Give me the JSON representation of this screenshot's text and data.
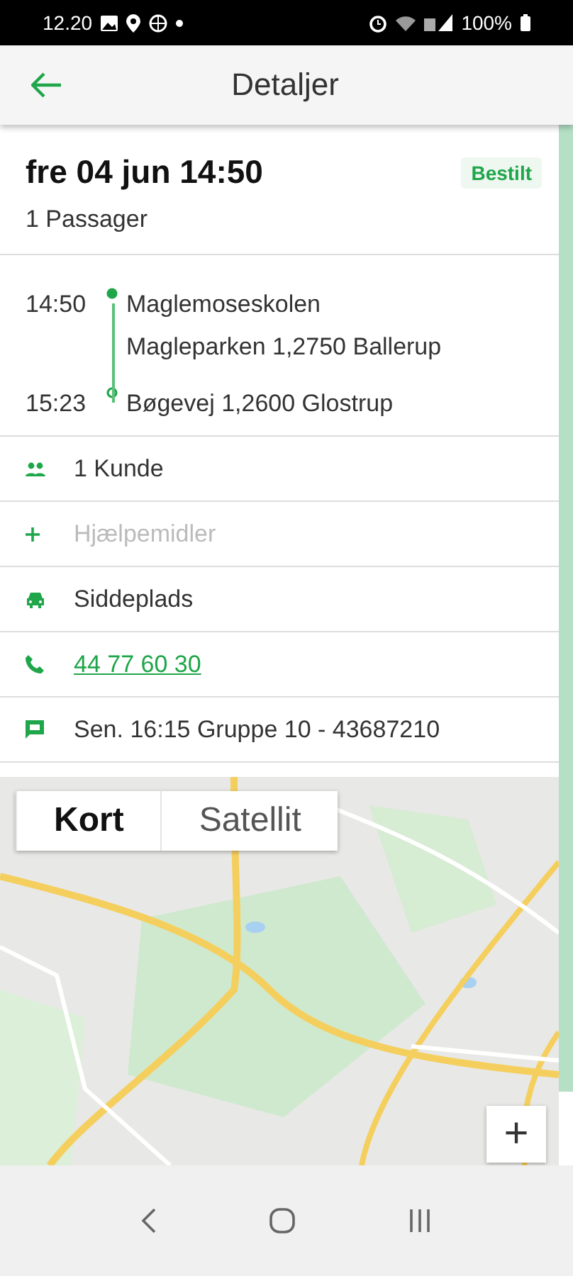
{
  "status_bar": {
    "time": "12.20",
    "battery": "100%"
  },
  "app_bar": {
    "title": "Detaljer"
  },
  "trip": {
    "date": "fre 04 jun 14:50",
    "status": "Bestilt",
    "passengers": "1 Passager"
  },
  "route": {
    "stops": [
      {
        "kind": "pickup",
        "time": "14:50",
        "lines": [
          "Maglemoseskolen",
          "Magleparken 1,2750 Ballerup"
        ]
      },
      {
        "kind": "dropoff",
        "time": "15:23",
        "lines": [
          "Bøgevej 1,2600 Glostrup"
        ]
      }
    ]
  },
  "details": [
    {
      "kind": "customers",
      "text": "1 Kunde",
      "disabled": false
    },
    {
      "kind": "aids",
      "text": "Hjælpemidler",
      "disabled": true
    },
    {
      "kind": "seat",
      "text": "Siddeplads",
      "disabled": false
    },
    {
      "kind": "phone",
      "text": "44 77 60 30",
      "disabled": false
    },
    {
      "kind": "message",
      "text": "Sen. 16:15 Gruppe 10 - 43687210",
      "disabled": false
    }
  ],
  "map": {
    "types": [
      {
        "label": "Kort",
        "selected": true
      },
      {
        "label": "Satellit",
        "selected": false
      }
    ],
    "zoom_in": "+"
  }
}
